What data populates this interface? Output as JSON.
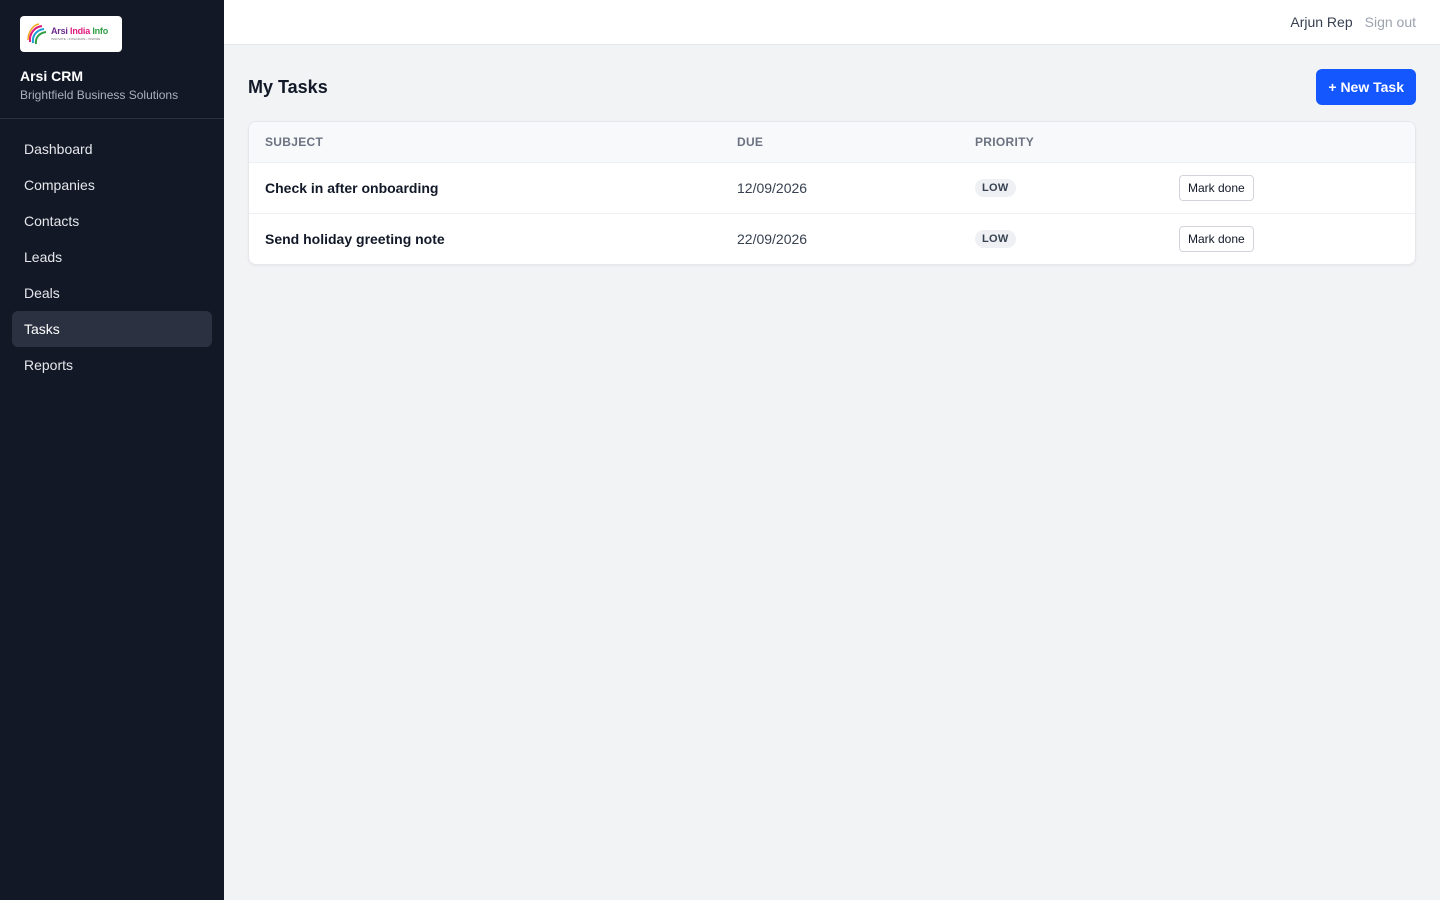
{
  "sidebar": {
    "logo": {
      "part1": "Arsi ",
      "part2": "India ",
      "part3": "Info",
      "tagline": "INNOVATE • INTEGRATE • INSPIRE"
    },
    "app_name": "Arsi CRM",
    "org_name": "Brightfield Business Solutions",
    "items": [
      {
        "label": "Dashboard",
        "active": false
      },
      {
        "label": "Companies",
        "active": false
      },
      {
        "label": "Contacts",
        "active": false
      },
      {
        "label": "Leads",
        "active": false
      },
      {
        "label": "Deals",
        "active": false
      },
      {
        "label": "Tasks",
        "active": true
      },
      {
        "label": "Reports",
        "active": false
      }
    ]
  },
  "topbar": {
    "user_name": "Arjun Rep",
    "sign_out_label": "Sign out"
  },
  "main": {
    "title": "My Tasks",
    "new_button_label": "+ New Task",
    "table": {
      "headers": [
        "SUBJECT",
        "DUE",
        "PRIORITY",
        ""
      ],
      "rows": [
        {
          "subject": "Check in after onboarding",
          "due": "12/09/2026",
          "priority": "LOW",
          "action": "Mark done"
        },
        {
          "subject": "Send holiday greeting note",
          "due": "22/09/2026",
          "priority": "LOW",
          "action": "Mark done"
        }
      ]
    }
  },
  "colors": {
    "sidebar_bg": "#121826",
    "accent": "#1557ff",
    "page_bg": "#f2f3f5"
  }
}
